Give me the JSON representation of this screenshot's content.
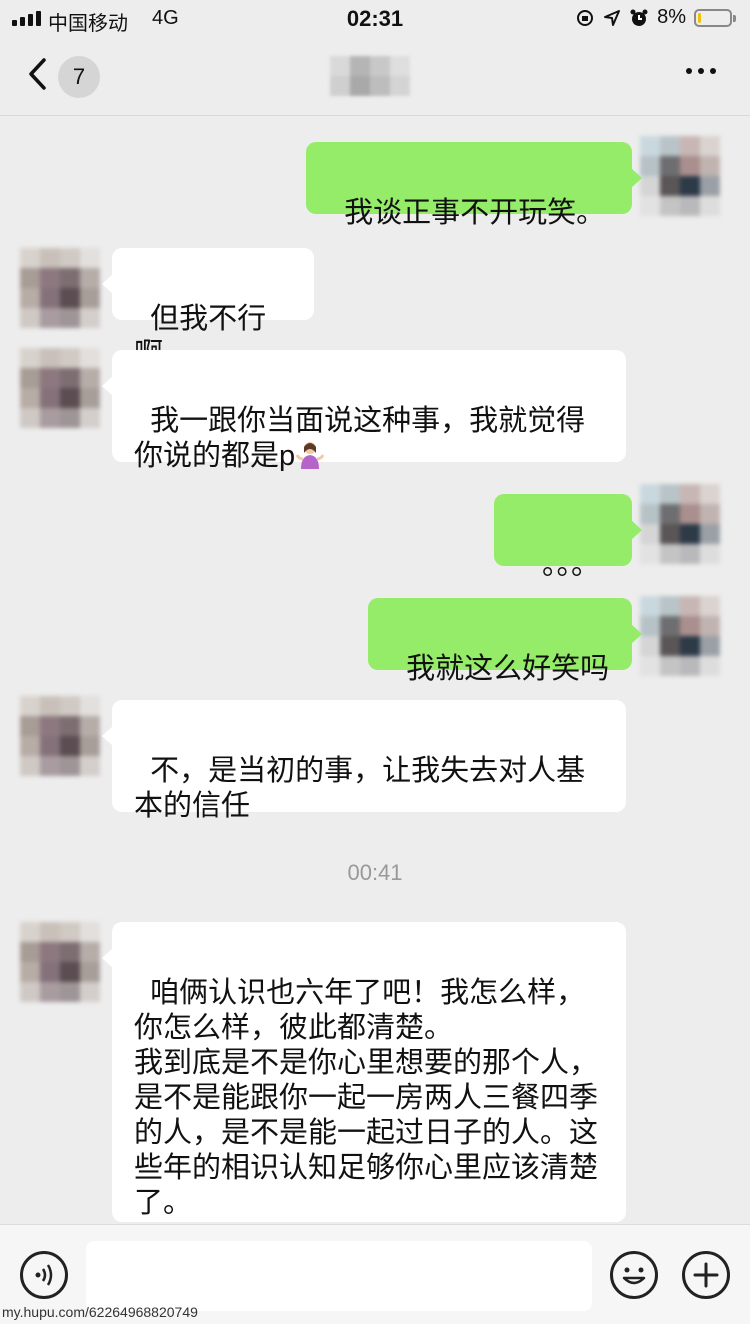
{
  "status_bar": {
    "carrier": "中国移动",
    "network": "4G",
    "time": "02:31",
    "battery_percent": "8%",
    "battery_level": 0.08,
    "icons": [
      "signal-icon",
      "orientation-lock-icon",
      "location-icon",
      "alarm-icon",
      "battery-icon"
    ]
  },
  "nav": {
    "back_icon": "chevron-left-icon",
    "unread_count": "7",
    "more_icon": "more-dots-icon"
  },
  "messages": [
    {
      "side": "out",
      "text": "我谈正事不开玩笑。"
    },
    {
      "side": "in",
      "text": "但我不行啊"
    },
    {
      "side": "in",
      "text": "我一跟你当面说这种事，我就觉得你说的都是p",
      "emoji": "person-shrugging-emoji"
    },
    {
      "side": "out",
      "text": "。。。"
    },
    {
      "side": "out",
      "text": "我就这么好笑吗"
    },
    {
      "side": "in",
      "text": "不，是当初的事，让我失去对人基本的信任"
    },
    {
      "side": "in",
      "text": "咱俩认识也六年了吧！我怎么样，你怎么样，彼此都清楚。\n我到底是不是你心里想要的那个人，是不是能跟你一起一房两人三餐四季的人，是不是能一起过日子的人。这些年的相识认知足够你心里应该清楚了。"
    }
  ],
  "timestamp": "00:41",
  "input_bar": {
    "voice_icon": "voice-icon",
    "emoji_icon": "emoji-icon",
    "add_icon": "plus-icon",
    "input_value": ""
  },
  "watermark": "my.hupu.com/62264968820749",
  "colors": {
    "background": "#ededed",
    "outgoing_bubble": "#95ec69",
    "incoming_bubble": "#ffffff"
  }
}
